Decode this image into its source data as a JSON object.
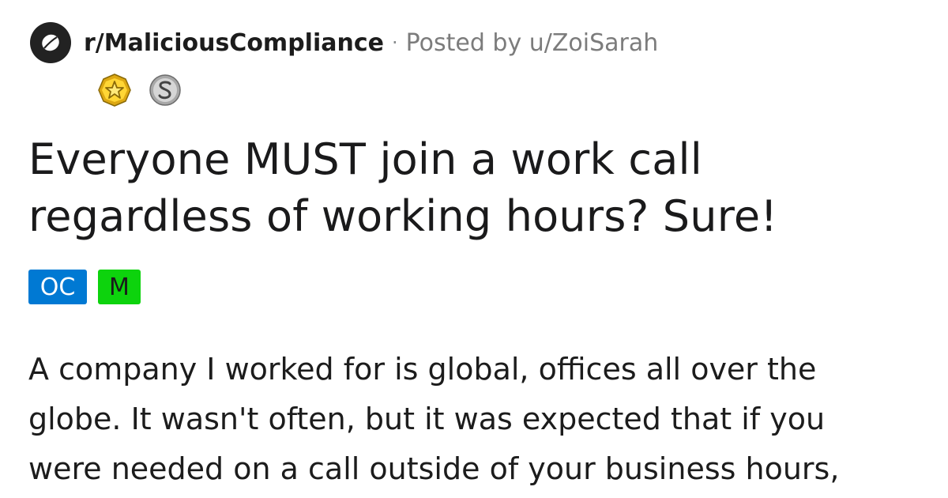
{
  "post": {
    "subreddit": "r/MaliciousCompliance",
    "separator": "·",
    "posted_by": "Posted by u/ZoiSarah",
    "awards": [
      {
        "icon": "gold-award-icon"
      },
      {
        "icon": "silver-award-icon"
      }
    ],
    "title_line_1": "Everyone MUST join a work call",
    "title_line_2": "regardless of working hours? Sure!",
    "flairs": [
      {
        "label": "OC",
        "color": "#0079d3"
      },
      {
        "label": "M",
        "color": "#0dd30d"
      }
    ],
    "body_lines": [
      "A company I worked for is global, offices all over the",
      "globe. It wasn't often, but it was expected that if you",
      "were needed on a call outside of your business hours,"
    ]
  }
}
